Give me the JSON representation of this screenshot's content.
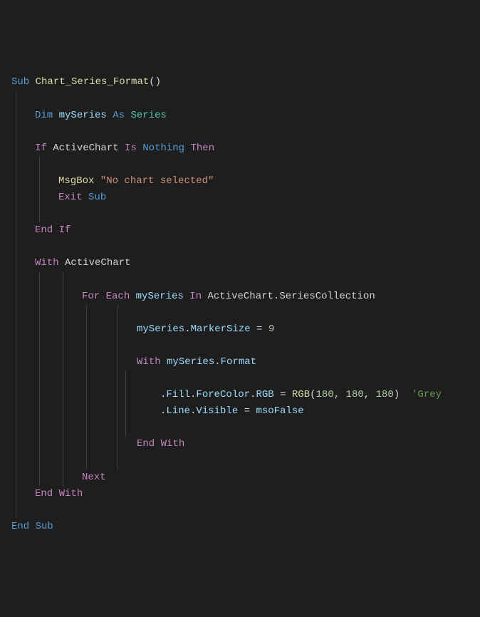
{
  "code": {
    "l1": {
      "sub": "Sub",
      "name": "Chart_Series_Format",
      "paren": "()"
    },
    "l3": {
      "dim": "Dim",
      "var": "mySeries",
      "as": "As",
      "type": "Series"
    },
    "l5": {
      "if": "If",
      "ac": "ActiveChart",
      "is": "Is",
      "nothing": "Nothing",
      "then": "Then"
    },
    "l7": {
      "msgbox": "MsgBox",
      "str": "\"No chart selected\""
    },
    "l8": {
      "exit": "Exit",
      "sub": "Sub"
    },
    "l10": {
      "end": "End",
      "if": "If"
    },
    "l12": {
      "with": "With",
      "ac": "ActiveChart"
    },
    "l14": {
      "for": "For",
      "each": "Each",
      "var": "mySeries",
      "in": "In",
      "ac": "ActiveChart",
      "dot": ".",
      "sc": "SeriesCollection"
    },
    "l16": {
      "var": "mySeries",
      "dot": ".",
      "ms": "MarkerSize",
      "eq": " = ",
      "num": "9"
    },
    "l18": {
      "with": "With",
      "var": "mySeries",
      "dot": ".",
      "fmt": "Format"
    },
    "l20": {
      "dot1": ".",
      "fill": "Fill",
      "dot2": ".",
      "fc": "ForeColor",
      "dot3": ".",
      "rgb": "RGB",
      "eq": " = ",
      "rgbf": "RGB",
      "open": "(",
      "n1": "180",
      "c1": ", ",
      "n2": "180",
      "c2": ", ",
      "n3": "180",
      "close": ")",
      "sp": "  ",
      "comment": "'Grey"
    },
    "l21": {
      "dot1": ".",
      "line": "Line",
      "dot2": ".",
      "vis": "Visible",
      "eq": " = ",
      "mso": "msoFalse"
    },
    "l23": {
      "end": "End",
      "with": "With"
    },
    "l25": {
      "next": "Next"
    },
    "l26": {
      "end": "End",
      "with": "With"
    },
    "l28": {
      "end": "End",
      "sub": "Sub"
    }
  },
  "guides": {
    "g1": 22,
    "g2": 55,
    "g3": 88,
    "g4": 121,
    "g5": 165,
    "g6": 176
  }
}
